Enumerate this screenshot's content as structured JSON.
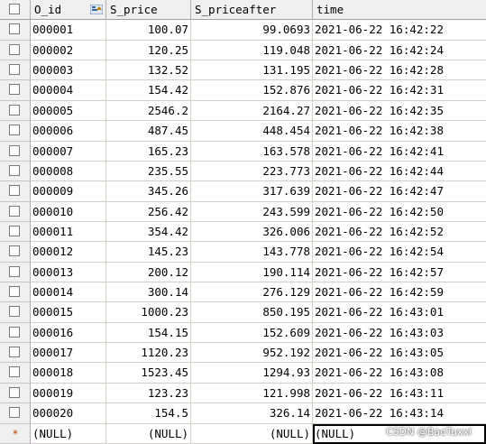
{
  "columns": [
    "O_id",
    "S_price",
    "S_priceafter",
    "time"
  ],
  "rows": [
    {
      "O_id": "000001",
      "S_price": "100.07",
      "S_priceafter": "99.0693",
      "time": "2021-06-22 16:42:22"
    },
    {
      "O_id": "000002",
      "S_price": "120.25",
      "S_priceafter": "119.048",
      "time": "2021-06-22 16:42:24"
    },
    {
      "O_id": "000003",
      "S_price": "132.52",
      "S_priceafter": "131.195",
      "time": "2021-06-22 16:42:28"
    },
    {
      "O_id": "000004",
      "S_price": "154.42",
      "S_priceafter": "152.876",
      "time": "2021-06-22 16:42:31"
    },
    {
      "O_id": "000005",
      "S_price": "2546.2",
      "S_priceafter": "2164.27",
      "time": "2021-06-22 16:42:35"
    },
    {
      "O_id": "000006",
      "S_price": "487.45",
      "S_priceafter": "448.454",
      "time": "2021-06-22 16:42:38"
    },
    {
      "O_id": "000007",
      "S_price": "165.23",
      "S_priceafter": "163.578",
      "time": "2021-06-22 16:42:41"
    },
    {
      "O_id": "000008",
      "S_price": "235.55",
      "S_priceafter": "223.773",
      "time": "2021-06-22 16:42:44"
    },
    {
      "O_id": "000009",
      "S_price": "345.26",
      "S_priceafter": "317.639",
      "time": "2021-06-22 16:42:47"
    },
    {
      "O_id": "000010",
      "S_price": "256.42",
      "S_priceafter": "243.599",
      "time": "2021-06-22 16:42:50"
    },
    {
      "O_id": "000011",
      "S_price": "354.42",
      "S_priceafter": "326.006",
      "time": "2021-06-22 16:42:52"
    },
    {
      "O_id": "000012",
      "S_price": "145.23",
      "S_priceafter": "143.778",
      "time": "2021-06-22 16:42:54"
    },
    {
      "O_id": "000013",
      "S_price": "200.12",
      "S_priceafter": "190.114",
      "time": "2021-06-22 16:42:57"
    },
    {
      "O_id": "000014",
      "S_price": "300.14",
      "S_priceafter": "276.129",
      "time": "2021-06-22 16:42:59"
    },
    {
      "O_id": "000015",
      "S_price": "1000.23",
      "S_priceafter": "850.195",
      "time": "2021-06-22 16:43:01"
    },
    {
      "O_id": "000016",
      "S_price": "154.15",
      "S_priceafter": "152.609",
      "time": "2021-06-22 16:43:03"
    },
    {
      "O_id": "000017",
      "S_price": "1120.23",
      "S_priceafter": "952.192",
      "time": "2021-06-22 16:43:05"
    },
    {
      "O_id": "000018",
      "S_price": "1523.45",
      "S_priceafter": "1294.93",
      "time": "2021-06-22 16:43:08"
    },
    {
      "O_id": "000019",
      "S_price": "123.23",
      "S_priceafter": "121.998",
      "time": "2021-06-22 16:43:11"
    },
    {
      "O_id": "000020",
      "S_price": "154.5",
      "S_priceafter": "326.14",
      "time": "2021-06-22 16:43:14"
    }
  ],
  "new_row": {
    "marker": "*",
    "O_id": "(NULL)",
    "S_price": "(NULL)",
    "S_priceafter": "(NULL)",
    "time": "(NULL)"
  },
  "icons": {
    "row_selector": "checkbox-icon",
    "key_column": "primary-key-sort-icon",
    "new_row": "new-row-star-icon"
  },
  "colors": {
    "grid_line": "#d4d0c8",
    "header_bg": "#f0f0f0",
    "new_row_marker": "#c04000"
  },
  "watermark": "CSDN @BaoTuxxl"
}
